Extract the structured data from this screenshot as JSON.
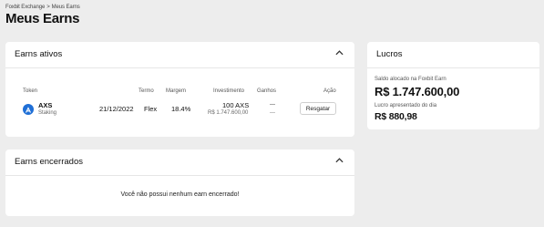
{
  "breadcrumb": {
    "root": "Foxbit Exchange",
    "separator": ">",
    "current": "Meus Earns"
  },
  "page_title": "Meus Earns",
  "active_earns": {
    "title": "Earns ativos",
    "columns": {
      "token": "Token",
      "term": "Termo",
      "margin": "Margem",
      "investment": "Investimento",
      "gains": "Ganhos",
      "action": "Ação"
    },
    "row": {
      "token": "AXS",
      "type": "Staking",
      "date": "21/12/2022",
      "term": "Flex",
      "margin": "18.4%",
      "investment": "100 AXS",
      "investment_brl": "R$ 1.747.600,00",
      "gains_1": "---",
      "gains_2": "---",
      "action_label": "Resgatar"
    },
    "icon_color": "#1f6fd6"
  },
  "closed_earns": {
    "title": "Earns encerrados",
    "empty_message": "Você não possui nenhum earn encerrado!"
  },
  "profits": {
    "title": "Lucros",
    "allocated_label": "Saldo alocado na Foxbit Earn",
    "allocated_value": "R$ 1.747.600,00",
    "earned_label": "Lucro apresentado do dia",
    "earned_value": "R$ 880,98"
  }
}
